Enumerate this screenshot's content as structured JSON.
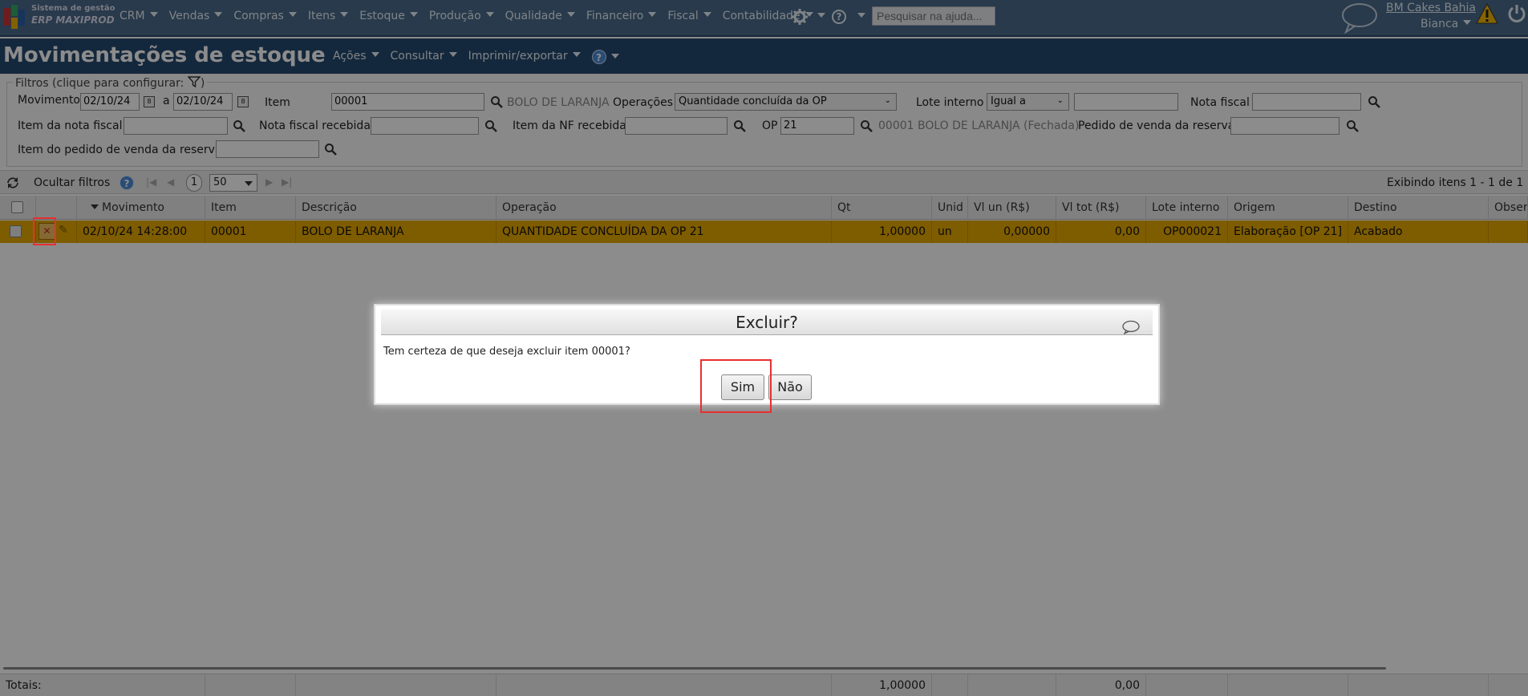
{
  "app": {
    "logo_line1": "Sistema de gestão",
    "logo_line2": "ERP MAXIPROD",
    "menu": [
      "CRM",
      "Vendas",
      "Compras",
      "Itens",
      "Estoque",
      "Produção",
      "Qualidade",
      "Financeiro",
      "Fiscal",
      "Contabilidade"
    ],
    "search_placeholder": "Pesquisar na ajuda...",
    "company": "BM Cakes Bahia",
    "user": "Bianca"
  },
  "page": {
    "title": "Movimentações de estoque",
    "actions": [
      "Ações",
      "Consultar",
      "Imprimir/exportar"
    ],
    "help": "?"
  },
  "filters": {
    "legend": "Filtros (clique para configurar:",
    "legend_end": ")",
    "movimento_label": "Movimento",
    "movimento_from": "02/10/24",
    "a_label": "a",
    "movimento_to": "02/10/24",
    "item_label": "Item",
    "item_value": "00001",
    "item_desc": "BOLO DE LARANJA",
    "operacoes_label": "Operações",
    "operacoes_value": "Quantidade concluída da OP",
    "lote_label": "Lote interno",
    "lote_select": "Igual a",
    "nota_fiscal_label": "Nota fiscal",
    "item_nota_label": "Item da nota fiscal",
    "nf_recebida_label": "Nota fiscal recebida",
    "item_nf_recebida_label": "Item da NF recebida",
    "op_label": "OP",
    "op_value": "21",
    "op_desc": "00001 BOLO DE LARANJA (Fechada)",
    "pedido_label": "Pedido de venda da reserva",
    "item_pedido_label": "Item do pedido de venda da reserva"
  },
  "toolbar": {
    "hide_filters": "Ocultar filtros",
    "help": "?",
    "page": "1",
    "page_size": "50",
    "status": "Exibindo itens 1 - 1 de 1"
  },
  "table": {
    "headers": [
      "Movimento",
      "Item",
      "Descrição",
      "Operação",
      "Qt",
      "Unid",
      "Vl un (R$)",
      "Vl tot (R$)",
      "Lote interno",
      "Origem",
      "Destino",
      "Obser"
    ],
    "row": {
      "movimento": "02/10/24 14:28:00",
      "item": "00001",
      "descricao": "BOLO DE LARANJA",
      "operacao": "QUANTIDADE CONCLUÍDA DA OP 21",
      "qt": "1,00000",
      "unid": "un",
      "vl_un": "0,00000",
      "vl_tot": "0,00",
      "lote": "OP000021",
      "origem": "Elaboração [OP 21]",
      "destino": "Acabado"
    },
    "totals_label": "Totais:",
    "total_qt": "1,00000",
    "total_vl": "0,00"
  },
  "dialog": {
    "title": "Excluir?",
    "message": "Tem certeza de que deseja excluir item 00001?",
    "yes": "Sim",
    "no": "Não"
  },
  "colors": {
    "nav": "#4a6a8a",
    "title_bar": "#264a70",
    "row_selected": "#e6a800",
    "highlight": "#e83030"
  }
}
